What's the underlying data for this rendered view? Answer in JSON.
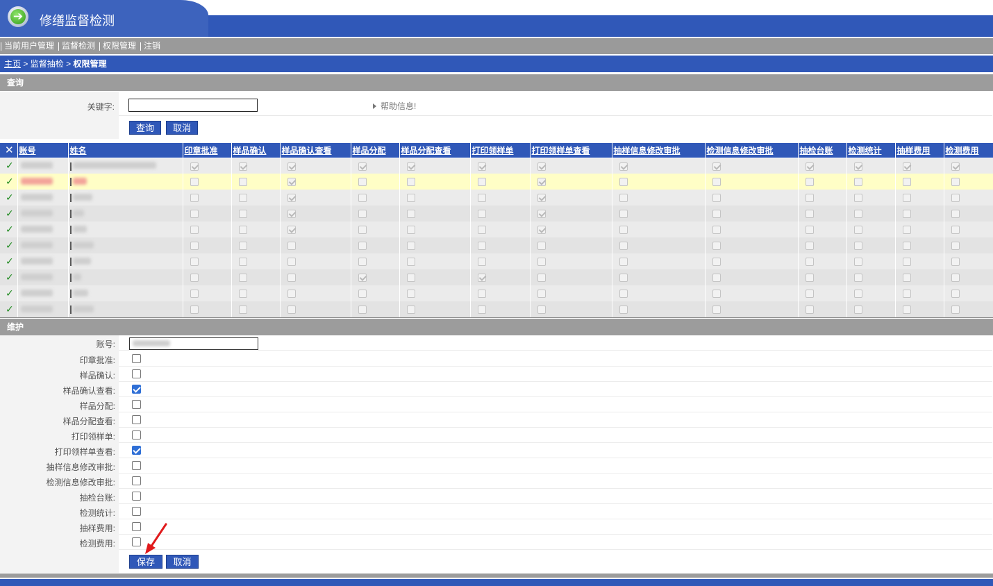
{
  "app": {
    "title": "修缮监督检测"
  },
  "topmenu": [
    "当前用户管理",
    "监督检测",
    "权限管理",
    "注销"
  ],
  "breadcrumb": {
    "home": "主页",
    "sep1": ">",
    "middle": "监督抽检",
    "sep2": ">",
    "current": "权限管理"
  },
  "query": {
    "section_title": "查询",
    "keyword_label": "关键字:",
    "keyword_value": "",
    "help_text": "帮助信息!",
    "search_button": "查询",
    "cancel_button": "取消"
  },
  "grid": {
    "headers": [
      "账号",
      "姓名",
      "印章批准",
      "样品确认",
      "样品确认查看",
      "样品分配",
      "样品分配查看",
      "打印领样单",
      "打印领样单查看",
      "抽样信息修改审批",
      "检测信息修改审批",
      "抽检台账",
      "检测统计",
      "抽样费用",
      "检测费用"
    ],
    "rows": [
      {
        "highlight": false,
        "perms": [
          true,
          true,
          true,
          true,
          true,
          true,
          true,
          true,
          true,
          true,
          true,
          true,
          true
        ]
      },
      {
        "highlight": true,
        "perms": [
          false,
          false,
          true,
          false,
          false,
          false,
          true,
          false,
          false,
          false,
          false,
          false,
          false
        ]
      },
      {
        "highlight": false,
        "perms": [
          false,
          false,
          true,
          false,
          false,
          false,
          true,
          false,
          false,
          false,
          false,
          false,
          false
        ]
      },
      {
        "highlight": false,
        "perms": [
          false,
          false,
          true,
          false,
          false,
          false,
          true,
          false,
          false,
          false,
          false,
          false,
          false
        ]
      },
      {
        "highlight": false,
        "perms": [
          false,
          false,
          true,
          false,
          false,
          false,
          true,
          false,
          false,
          false,
          false,
          false,
          false
        ]
      },
      {
        "highlight": false,
        "perms": [
          false,
          false,
          false,
          false,
          false,
          false,
          false,
          false,
          false,
          false,
          false,
          false,
          false
        ]
      },
      {
        "highlight": false,
        "perms": [
          false,
          false,
          false,
          false,
          false,
          false,
          false,
          false,
          false,
          false,
          false,
          false,
          false
        ]
      },
      {
        "highlight": false,
        "perms": [
          false,
          false,
          false,
          true,
          false,
          true,
          false,
          false,
          false,
          false,
          false,
          false,
          false
        ]
      },
      {
        "highlight": false,
        "perms": [
          false,
          false,
          false,
          false,
          false,
          false,
          false,
          false,
          false,
          false,
          false,
          false,
          false
        ]
      },
      {
        "highlight": false,
        "perms": [
          false,
          false,
          false,
          false,
          false,
          false,
          false,
          false,
          false,
          false,
          false,
          false,
          false
        ]
      }
    ]
  },
  "maintenance": {
    "section_title": "维护",
    "account_label": "账号:",
    "fields": [
      {
        "label": "印章批准:",
        "checked": false
      },
      {
        "label": "样品确认:",
        "checked": false
      },
      {
        "label": "样品确认查看:",
        "checked": true
      },
      {
        "label": "样品分配:",
        "checked": false
      },
      {
        "label": "样品分配查看:",
        "checked": false
      },
      {
        "label": "打印领样单:",
        "checked": false
      },
      {
        "label": "打印领样单查看:",
        "checked": true
      },
      {
        "label": "抽样信息修改审批:",
        "checked": false
      },
      {
        "label": "检测信息修改审批:",
        "checked": false
      },
      {
        "label": "抽检台账:",
        "checked": false
      },
      {
        "label": "检测统计:",
        "checked": false
      },
      {
        "label": "抽样费用:",
        "checked": false
      },
      {
        "label": "检测费用:",
        "checked": false
      }
    ],
    "save_button": "保存",
    "cancel_button": "取消"
  },
  "colors": {
    "primary": "#3058b8",
    "section_gray": "#9c9c9c",
    "highlight_row": "#fffec6",
    "check_green": "#1f8a1f",
    "annotation_arrow": "#e0191b"
  }
}
